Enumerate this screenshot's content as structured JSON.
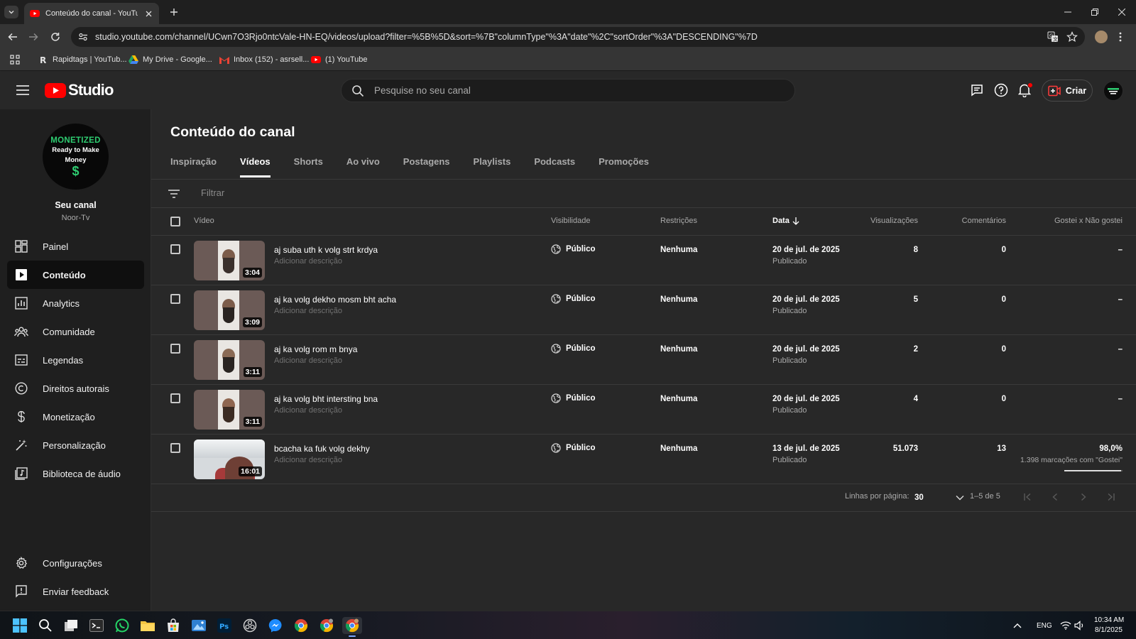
{
  "browser": {
    "tab_title": "Conteúdo do canal - YouTube Studio",
    "url": "studio.youtube.com/channel/UCwn7O3Rjo0ntcVale-HN-EQ/videos/upload?filter=%5B%5D&sort=%7B\"columnType\"%3A\"date\"%2C\"sortOrder\"%3A\"DESCENDING\"%7D",
    "bookmarks": [
      {
        "label": "Rapidtags | YouTub...",
        "icon": "rapidtags-icon"
      },
      {
        "label": "My Drive - Google...",
        "icon": "google-drive-icon"
      },
      {
        "label": "Inbox (152) - asrsell...",
        "icon": "gmail-icon"
      },
      {
        "label": "(1) YouTube",
        "icon": "youtube-icon"
      }
    ]
  },
  "header": {
    "logo_text": "Studio",
    "search_placeholder": "Pesquise no seu canal",
    "create_label": "Criar"
  },
  "sidebar": {
    "avatar_line1": "MONETIZED",
    "avatar_line2": "Ready to Make",
    "avatar_line3": "Money",
    "avatar_symbol": "$",
    "channel_title": "Seu canal",
    "channel_handle": "Noor-Tv",
    "items": [
      {
        "label": "Painel",
        "icon": "dashboard-icon"
      },
      {
        "label": "Conteúdo",
        "icon": "content-icon",
        "active": true
      },
      {
        "label": "Analytics",
        "icon": "analytics-icon"
      },
      {
        "label": "Comunidade",
        "icon": "community-icon"
      },
      {
        "label": "Legendas",
        "icon": "subtitles-icon"
      },
      {
        "label": "Direitos autorais",
        "icon": "copyright-icon"
      },
      {
        "label": "Monetização",
        "icon": "dollar-icon"
      },
      {
        "label": "Personalização",
        "icon": "magic-wand-icon"
      },
      {
        "label": "Biblioteca de áudio",
        "icon": "audio-library-icon"
      }
    ],
    "bottom_items": [
      {
        "label": "Configurações",
        "icon": "gear-icon"
      },
      {
        "label": "Enviar feedback",
        "icon": "feedback-icon"
      }
    ]
  },
  "main": {
    "title": "Conteúdo do canal",
    "tabs": [
      "Inspiração",
      "Vídeos",
      "Shorts",
      "Ao vivo",
      "Postagens",
      "Playlists",
      "Podcasts",
      "Promoções"
    ],
    "active_tab": "Vídeos",
    "filter_placeholder": "Filtrar",
    "columns": {
      "video": "Vídeo",
      "visibility": "Visibilidade",
      "restrictions": "Restrições",
      "date": "Data",
      "views": "Visualizações",
      "comments": "Comentários",
      "likes": "Gostei x Não gostei"
    },
    "videos": [
      {
        "title": "aj suba uth k volg strt krdya",
        "description": "Adicionar descrição",
        "duration": "3:04",
        "visibility": "Público",
        "restrictions": "Nenhuma",
        "date": "20 de jul. de 2025",
        "status": "Publicado",
        "views": "8",
        "comments": "0",
        "likes": "–"
      },
      {
        "title": "aj ka volg dekho mosm bht acha",
        "description": "Adicionar descrição",
        "duration": "3:09",
        "visibility": "Público",
        "restrictions": "Nenhuma",
        "date": "20 de jul. de 2025",
        "status": "Publicado",
        "views": "5",
        "comments": "0",
        "likes": "–"
      },
      {
        "title": "aj ka volg rom m bnya",
        "description": "Adicionar descrição",
        "duration": "3:11",
        "visibility": "Público",
        "restrictions": "Nenhuma",
        "date": "20 de jul. de 2025",
        "status": "Publicado",
        "views": "2",
        "comments": "0",
        "likes": "–"
      },
      {
        "title": "aj ka volg bht intersting bna",
        "description": "Adicionar descrição",
        "duration": "3:11",
        "visibility": "Público",
        "restrictions": "Nenhuma",
        "date": "20 de jul. de 2025",
        "status": "Publicado",
        "views": "4",
        "comments": "0",
        "likes": "–"
      },
      {
        "title": "bcacha ka fuk volg dekhy",
        "description": "Adicionar descrição",
        "duration": "16:01",
        "visibility": "Público",
        "restrictions": "Nenhuma",
        "date": "13 de jul. de 2025",
        "status": "Publicado",
        "views": "51.073",
        "comments": "13",
        "likes": "98,0%",
        "likes_sub": "1.398 marcações com \"Gostei\"",
        "like_ratio": 0.98
      }
    ],
    "pager": {
      "rows_label": "Linhas por página:",
      "rows_value": "30",
      "range": "1–5 de 5"
    }
  },
  "taskbar": {
    "language": "ENG",
    "time": "10:34 AM",
    "date": "8/1/2025"
  },
  "colors": {
    "youtube_red": "#ff0000",
    "background": "#282828",
    "sidebar": "#1f1f1f"
  }
}
